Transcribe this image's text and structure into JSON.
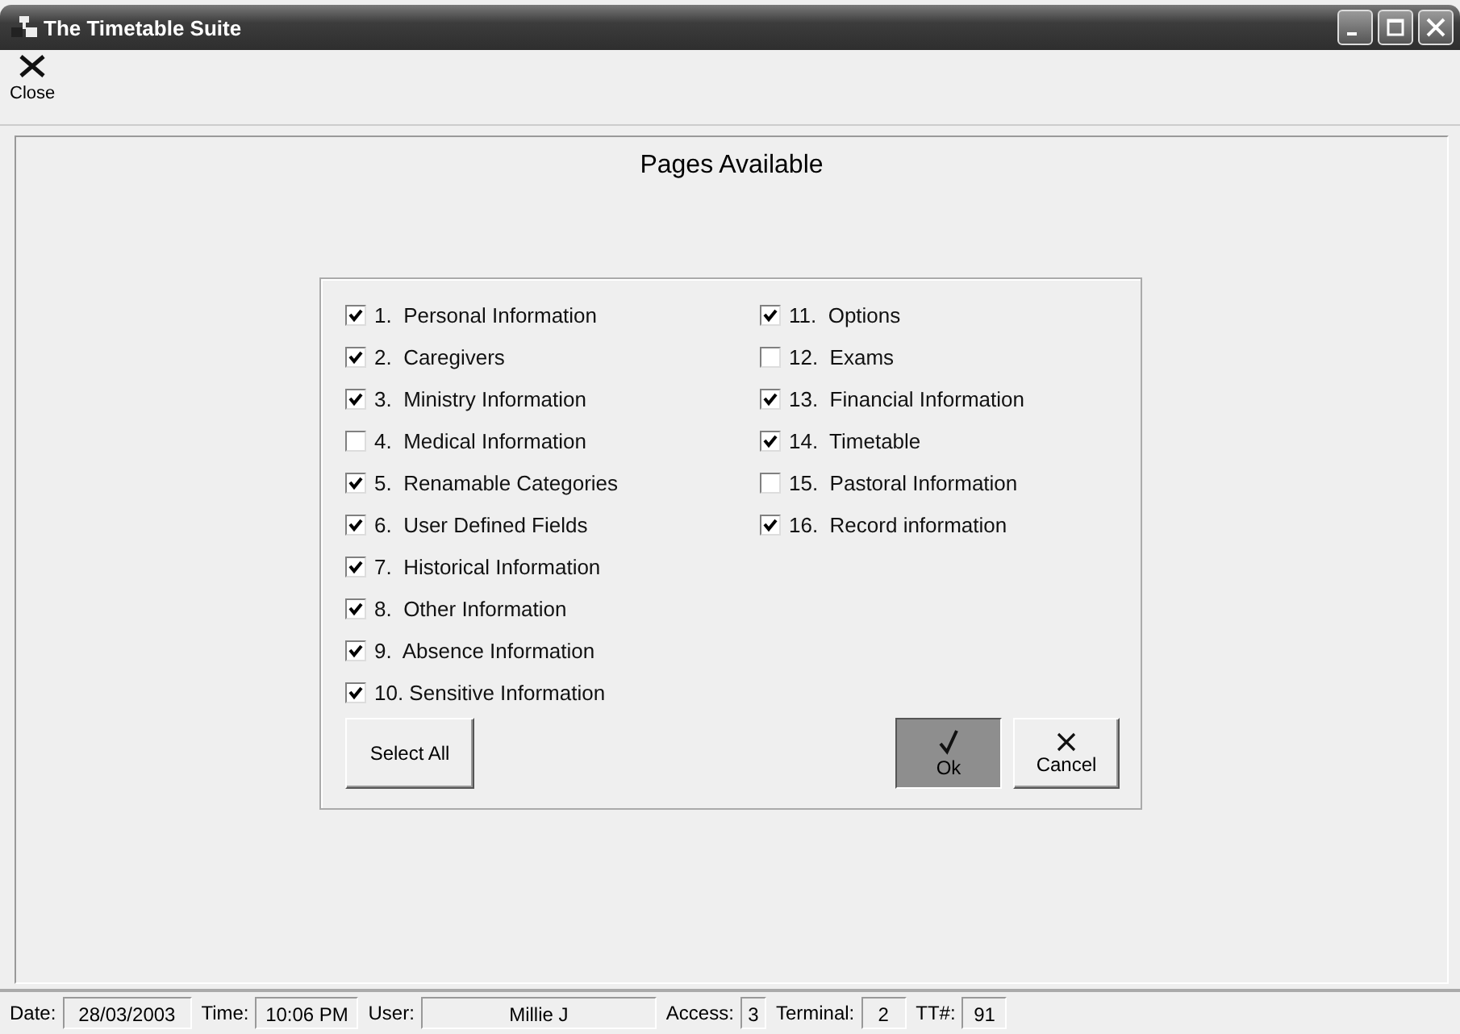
{
  "window": {
    "title": "The Timetable Suite"
  },
  "toolbar": [
    {
      "label": "Close"
    }
  ],
  "heading": "Pages Available",
  "pages_left": [
    {
      "label": "1.  Personal Information",
      "checked": true
    },
    {
      "label": "2.  Caregivers",
      "checked": true
    },
    {
      "label": "3.  Ministry Information",
      "checked": true
    },
    {
      "label": "4.  Medical Information",
      "checked": false
    },
    {
      "label": "5.  Renamable Categories",
      "checked": true
    },
    {
      "label": "6.  User Defined Fields",
      "checked": true
    },
    {
      "label": "7.  Historical Information",
      "checked": true
    },
    {
      "label": "8.  Other Information",
      "checked": true
    },
    {
      "label": "9.  Absence Information",
      "checked": true
    },
    {
      "label": "10. Sensitive Information",
      "checked": true
    }
  ],
  "pages_right": [
    {
      "label": "11.  Options",
      "checked": true
    },
    {
      "label": "12.  Exams",
      "checked": false
    },
    {
      "label": "13.  Financial Information",
      "checked": true
    },
    {
      "label": "14.  Timetable",
      "checked": true
    },
    {
      "label": "15.  Pastoral Information",
      "checked": false
    },
    {
      "label": "16.  Record information",
      "checked": true
    }
  ],
  "select_all": "Select All",
  "buttons": [
    {
      "kind": "ok",
      "label": "Ok",
      "pressed": true
    },
    {
      "kind": "cancel",
      "label": "Cancel",
      "pressed": false
    }
  ],
  "status_bar": [
    {
      "label": "Date:",
      "value": "28/03/2003"
    },
    {
      "label": "Time:",
      "value": "10:06 PM"
    },
    {
      "label": "User:",
      "value": "Millie J"
    },
    {
      "label": "Access:",
      "value": "3"
    },
    {
      "label": "Terminal:",
      "value": "2"
    },
    {
      "label": "TT#:",
      "value": "91"
    }
  ]
}
